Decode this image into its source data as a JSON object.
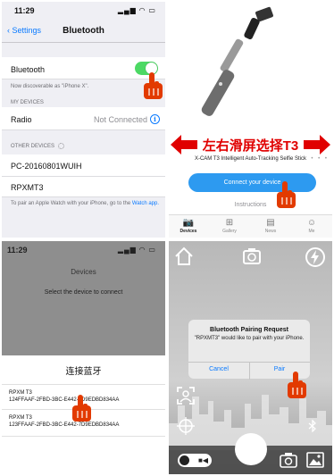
{
  "panel1": {
    "time": "11:29",
    "status_icons": "▂▄▆ ◠ ▭",
    "back_label": "Settings",
    "title": "Bluetooth",
    "bluetooth_label": "Bluetooth",
    "discoverable_text": "Now discoverable as \"iPhone X\".",
    "my_devices_header": "MY DEVICES",
    "radio_label": "Radio",
    "radio_status": "Not Connected",
    "other_devices_header": "OTHER DEVICES",
    "other_devices": [
      "PC-20160801WUIH",
      "RPXMT3"
    ],
    "footnote": "To pair an Apple Watch with your iPhone, go to the",
    "footnote_link": "Watch app.",
    "accent": "#0a7aff",
    "toggle_color": "#4cd964"
  },
  "panel2": {
    "banner": "左右滑屏选择T3",
    "product_name": "X-CAM T3 Intelligent Auto-Tracking Selfie Stick",
    "carousel_dots": "• • •",
    "connect_button": "Connect your device",
    "instructions": "Instructions",
    "tabs": [
      {
        "label": "Devices",
        "icon": "camera-icon"
      },
      {
        "label": "Gallery",
        "icon": "grid-icon"
      },
      {
        "label": "News",
        "icon": "news-icon"
      },
      {
        "label": "Me",
        "icon": "person-icon"
      }
    ],
    "banner_color": "#e00000",
    "button_color": "#2d9af0"
  },
  "panel3": {
    "time": "11:29",
    "status_icons": "▂▄▆ ◠ ▭",
    "title": "Devices",
    "subtitle": "Select the device to connect",
    "sheet_title": "连接蓝牙",
    "devices": [
      {
        "name": "RPXM T3",
        "id": "124FFAAF-2FBD-3BC-E442-7D9EDBD834AA"
      },
      {
        "name": "RPXM T3",
        "id": "123FFAAF-2FBD-3BC-E442-7D9EDBD834AA"
      }
    ]
  },
  "panel4": {
    "dialog_title": "Bluetooth Pairing Request",
    "dialog_message": "\"RPXMT3\" would like to pair with your iPhone.",
    "cancel_label": "Cancel",
    "pair_label": "Pair",
    "icons": [
      "home-icon",
      "camera-switch-icon",
      "flash-icon",
      "face-track-icon",
      "target-icon",
      "bluetooth-icon",
      "photo-video-toggle-icon",
      "shutter-icon",
      "camera-icon",
      "gallery-icon"
    ]
  }
}
